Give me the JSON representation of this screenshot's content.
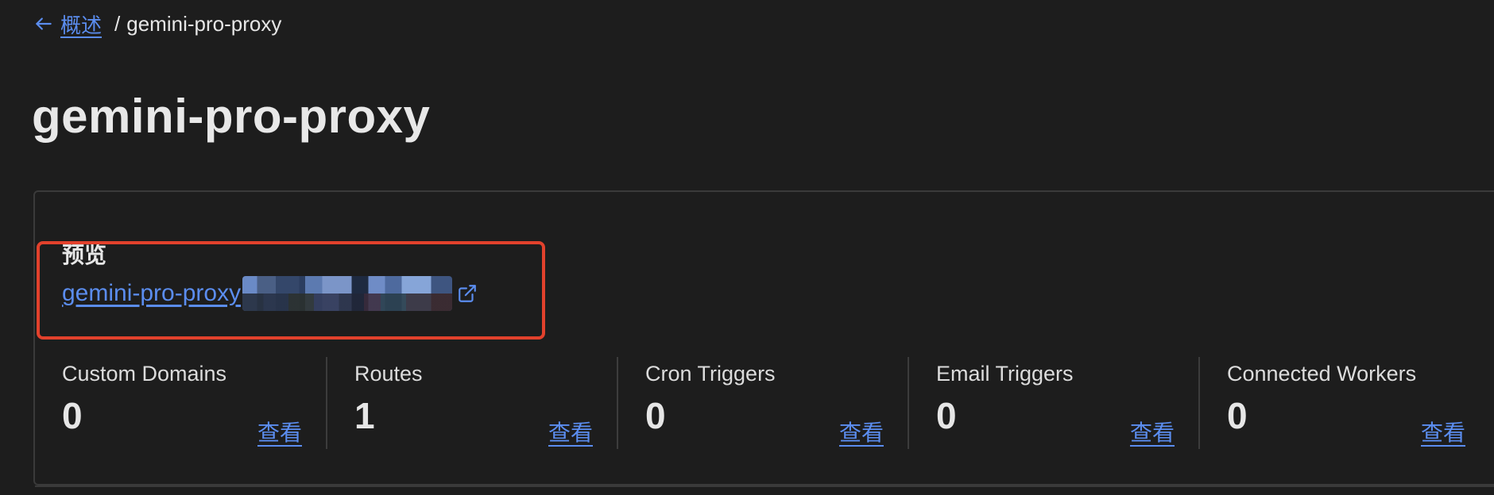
{
  "breadcrumb": {
    "back_label": "概述",
    "separator": "/",
    "current": "gemini-pro-proxy"
  },
  "page": {
    "title": "gemini-pro-proxy"
  },
  "preview": {
    "label": "预览",
    "url_text": "gemini-pro-proxy"
  },
  "stats": [
    {
      "label": "Custom Domains",
      "value": "0",
      "link": "查看"
    },
    {
      "label": "Routes",
      "value": "1",
      "link": "查看"
    },
    {
      "label": "Cron Triggers",
      "value": "0",
      "link": "查看"
    },
    {
      "label": "Email Triggers",
      "value": "0",
      "link": "查看"
    },
    {
      "label": "Connected Workers",
      "value": "0",
      "link": "查看"
    }
  ],
  "colors": {
    "background": "#1d1d1d",
    "link": "#5b8def",
    "highlight": "#e2412c"
  },
  "icons": {
    "back": "arrow-left-icon",
    "external": "external-link-icon"
  }
}
